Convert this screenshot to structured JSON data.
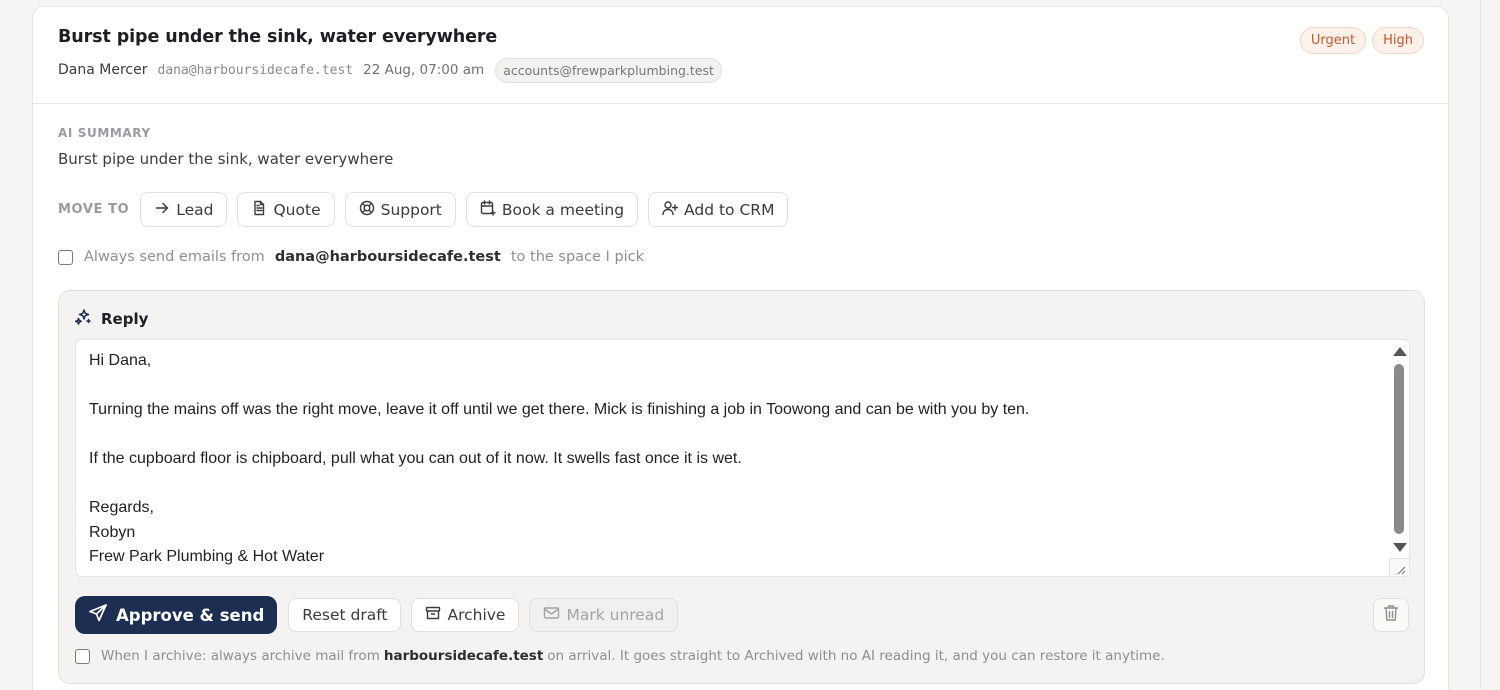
{
  "email": {
    "subject": "Burst pipe under the sink, water everywhere",
    "sender_name": "Dana Mercer",
    "sender_email": "dana@harboursidecafe.test",
    "sent_time": "22 Aug, 07:00 am",
    "to_chip": "accounts@frewparkplumbing.test",
    "badges": [
      "Urgent",
      "High"
    ]
  },
  "summary": {
    "label": "AI SUMMARY",
    "text": "Burst pipe under the sink, water everywhere"
  },
  "move_to": {
    "label": "MOVE TO",
    "buttons": [
      {
        "label": "Lead",
        "icon": "arrow-right-icon"
      },
      {
        "label": "Quote",
        "icon": "document-icon"
      },
      {
        "label": "Support",
        "icon": "lifebuoy-icon"
      },
      {
        "label": "Book a meeting",
        "icon": "calendar-add-icon"
      },
      {
        "label": "Add to CRM",
        "icon": "user-plus-icon"
      }
    ]
  },
  "always_send": {
    "checked": false,
    "prefix": "Always send emails from",
    "email": "dana@harboursidecafe.test",
    "suffix": "to the space I pick"
  },
  "reply": {
    "title": "Reply",
    "lines": [
      "Hi Dana,",
      "",
      "Turning the mains off was the right move, leave it off until we get there. Mick is finishing a job in Toowong and can be with you by ten.",
      "",
      "If the cupboard floor is chipboard, pull what you can out of it now. It swells fast once it is wet.",
      "",
      "Regards,",
      "Robyn",
      "Frew Park Plumbing & Hot Water"
    ]
  },
  "actions": {
    "approve_send": "Approve & send",
    "reset_draft": "Reset draft",
    "archive": "Archive",
    "mark_unread": "Mark unread"
  },
  "archive_rule": {
    "checked": false,
    "prefix": "When I archive: always archive mail from",
    "domain": "harboursidecafe.test",
    "suffix": "on arrival. It goes straight to Archived with no AI reading it, and you can restore it anytime."
  },
  "colors": {
    "primary": "#1c2e52",
    "badge_text": "#c4592b",
    "badge_bg": "#fdf1ea"
  }
}
